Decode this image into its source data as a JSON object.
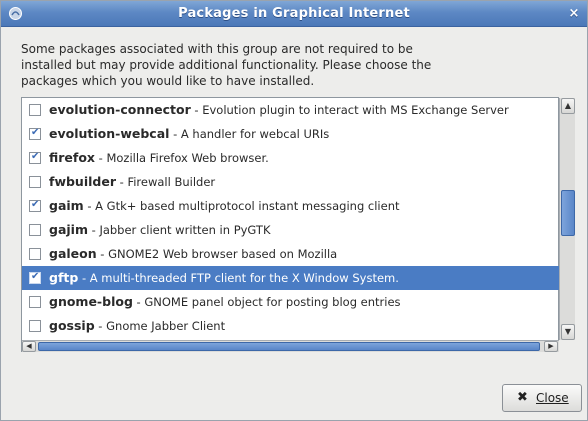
{
  "window": {
    "title": "Packages in Graphical Internet",
    "close_glyph": "×"
  },
  "description": "Some packages associated with this group are not required to be installed but may provide additional functionality.  Please choose the packages which you would like to have installed.",
  "packages": [
    {
      "name": "evolution-connector",
      "desc": " - Evolution plugin to interact with MS Exchange Server",
      "checked": false,
      "selected": false
    },
    {
      "name": "evolution-webcal",
      "desc": " - A handler for webcal URIs",
      "checked": true,
      "selected": false
    },
    {
      "name": "firefox",
      "desc": " - Mozilla Firefox Web browser.",
      "checked": true,
      "selected": false
    },
    {
      "name": "fwbuilder",
      "desc": " - Firewall Builder",
      "checked": false,
      "selected": false
    },
    {
      "name": "gaim",
      "desc": " - A Gtk+ based multiprotocol instant messaging client",
      "checked": true,
      "selected": false
    },
    {
      "name": "gajim",
      "desc": " - Jabber client written in PyGTK",
      "checked": false,
      "selected": false
    },
    {
      "name": "galeon",
      "desc": " - GNOME2 Web browser based on Mozilla",
      "checked": false,
      "selected": false
    },
    {
      "name": "gftp",
      "desc": " - A multi-threaded FTP client for the X Window System.",
      "checked": true,
      "selected": true
    },
    {
      "name": "gnome-blog",
      "desc": " - GNOME panel object for posting blog entries",
      "checked": false,
      "selected": false
    },
    {
      "name": "gossip",
      "desc": " - Gnome Jabber Client",
      "checked": false,
      "selected": false
    }
  ],
  "scrollbars": {
    "up_arrow": "▲",
    "down_arrow": "▼",
    "left_arrow": "◀",
    "right_arrow": "▶"
  },
  "close_button": {
    "icon": "✖",
    "label": "Close"
  },
  "colors": {
    "title_bar": "#5d88c4",
    "selection": "#4a7cc4",
    "check": "#3d6cb5"
  },
  "icons": {
    "app": "app-icon",
    "check": "check-icon"
  }
}
